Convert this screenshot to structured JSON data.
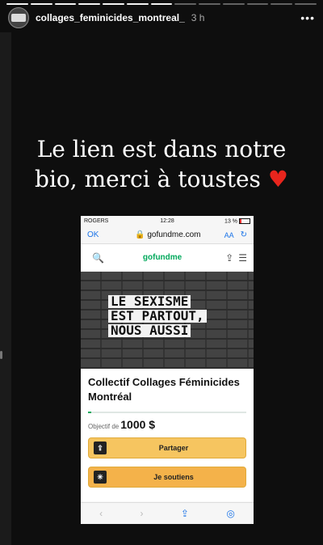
{
  "story": {
    "username": "collages_feminicides_montreal_",
    "time": "3 h",
    "caption_line1": "Le lien est dans notre",
    "caption_line2": "bio, merci à toustes",
    "heart": "♥"
  },
  "phone": {
    "carrier": "ROGERS",
    "clock": "12:28",
    "battery": "13 %",
    "ok_label": "OK",
    "url": "gofundme.com",
    "aa_label": "AA",
    "logo": "gofundme",
    "sign_lines": [
      "LE SEXISME",
      "EST PARTOUT,",
      "NOUS AUSSI"
    ],
    "campaign_title": "Collectif Collages Féminicides Montréal",
    "goal_label": "Objectif de",
    "goal_amount": "1000 $",
    "share_label": "Partager",
    "support_label": "Je soutiens",
    "progress_fraction": 0.02
  }
}
